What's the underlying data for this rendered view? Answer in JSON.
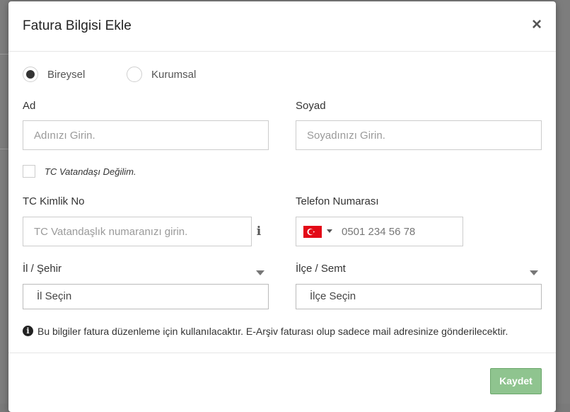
{
  "modal": {
    "title": "Fatura Bilgisi Ekle",
    "close_icon": "close-icon"
  },
  "type_options": {
    "individual": "Bireysel",
    "corporate": "Kurumsal",
    "selected": "Bireysel"
  },
  "fields": {
    "first_name_label": "Ad",
    "first_name_placeholder": "Adınızı Girin.",
    "last_name_label": "Soyad",
    "last_name_placeholder": "Soyadınızı Girin.",
    "not_citizen_label": "TC Vatandaşı Değilim.",
    "tc_label": "TC Kimlik No",
    "tc_placeholder": "TC Vatandaşlık numaranızı girin.",
    "phone_label": "Telefon Numarası",
    "phone_placeholder": "0501 234 56 78",
    "phone_country_flag": "turkey-flag-icon",
    "city_label": "İl / Şehir",
    "city_value": "İl Seçin",
    "district_label": "İlçe / Semt",
    "district_value": "İlçe Seçin"
  },
  "note": "Bu bilgiler fatura düzenleme için kullanılacaktır. E-Arşiv faturası olup sadece mail adresinize gönderilecektir.",
  "footer": {
    "save_label": "Kaydet"
  },
  "colors": {
    "save_button": "#8fc48f",
    "flag_red": "#e30a17"
  }
}
